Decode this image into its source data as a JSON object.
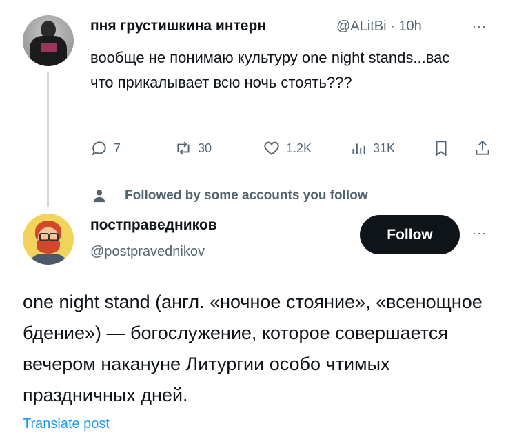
{
  "tweet1": {
    "name": "пня грустишкина интерн",
    "handle": "@ALitBi",
    "time": "· 10h",
    "more": "···",
    "text": "вообще не понимаю культуру one night stands...вас что прикалывает всю ночь стоять???",
    "stats": {
      "replies": "7",
      "reposts": "30",
      "likes": "1.2K",
      "views": "31K"
    }
  },
  "social_context": {
    "text": "Followed by some accounts you follow"
  },
  "tweet2": {
    "name": "постправедников",
    "handle": "@postpravednikov",
    "follow_label": "Follow",
    "more": "···",
    "text": "one night stand (англ. «ночное стояние», «всенощное бдение») — богослужение, которое совершается вечером накануне Литургии особо чтимых праздничных дней.",
    "translate_label": "Translate post"
  },
  "colors": {
    "text": "#0f1419",
    "secondary": "#536471",
    "link": "#1d9bf0",
    "thread_line": "#cfd9de",
    "button_bg": "#0f1419"
  },
  "icons": [
    "reply-icon",
    "repost-icon",
    "like-icon",
    "views-icon",
    "bookmark-icon",
    "share-icon",
    "person-icon"
  ]
}
